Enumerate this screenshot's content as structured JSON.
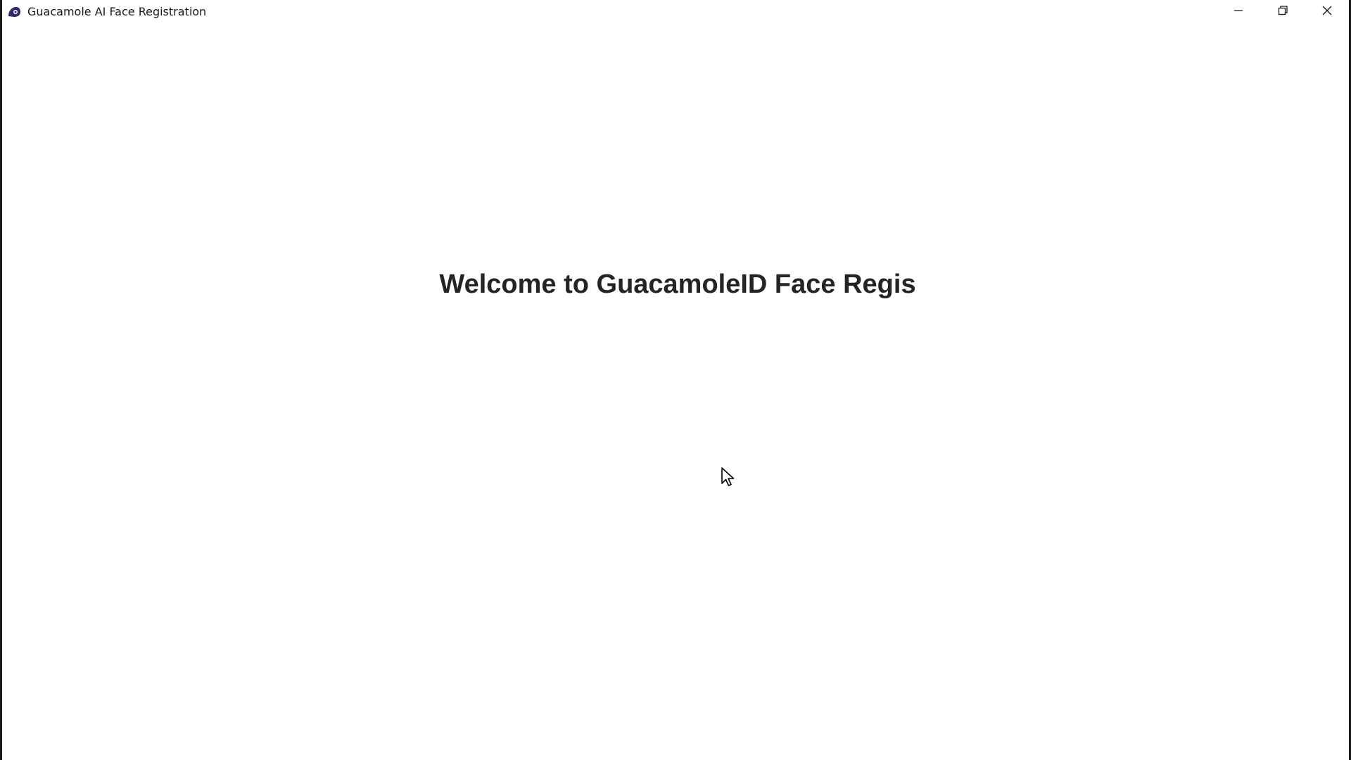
{
  "window": {
    "title": "Guacamole AI Face Registration",
    "icon": "guacamole-app-icon",
    "controls": [
      "minimize-icon",
      "restore-icon",
      "close-icon"
    ]
  },
  "main": {
    "welcome_text": "Welcome to GuacamoleID Face Regis"
  },
  "colors": {
    "background": "#ffffff",
    "text": "#242424",
    "icon_accent": "#2e2a6e"
  }
}
